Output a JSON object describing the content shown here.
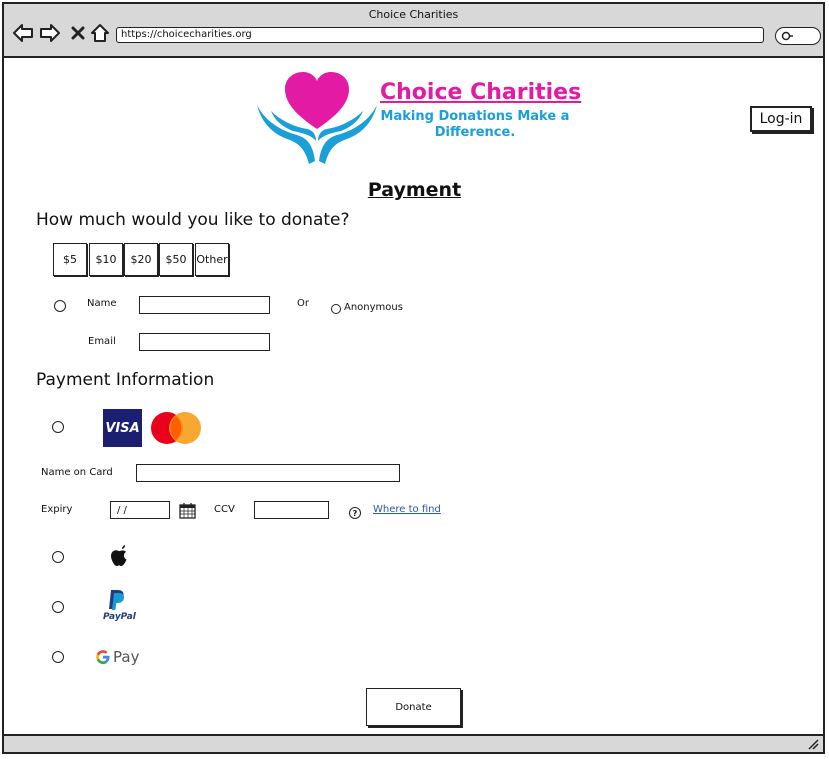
{
  "window": {
    "title": "Choice Charities",
    "url": "https://choicecharities.org"
  },
  "brand": {
    "name": "Choice Charities",
    "tagline": "Making Donations Make a Difference.",
    "colors": {
      "primary": "#e31aa3",
      "secondary": "#1a9fd8"
    }
  },
  "header": {
    "login_label": "Log-in"
  },
  "page": {
    "title": "Payment"
  },
  "donation": {
    "question": "How much would you like to donate?",
    "amounts": [
      "$5",
      "$10",
      "$20",
      "$50",
      "Other"
    ]
  },
  "donor": {
    "name_label": "Name",
    "name_value": "",
    "or_label": "Or",
    "anonymous_label": "Anonymous",
    "email_label": "Email",
    "email_value": ""
  },
  "payment": {
    "heading": "Payment Information",
    "visa_label": "VISA",
    "name_on_card_label": "Name on Card",
    "name_on_card_value": "",
    "expiry_label": "Expiry",
    "expiry_value": "/ /",
    "ccv_label": "CCV",
    "ccv_value": "",
    "where_to_find": "Where to find",
    "paypal_label": "PayPal",
    "gpay_label": "Pay",
    "icons": [
      "visa-icon",
      "mastercard-icon",
      "calendar-icon",
      "help-icon",
      "apple-icon",
      "paypal-icon",
      "google-icon"
    ]
  },
  "submit": {
    "label": "Donate"
  }
}
